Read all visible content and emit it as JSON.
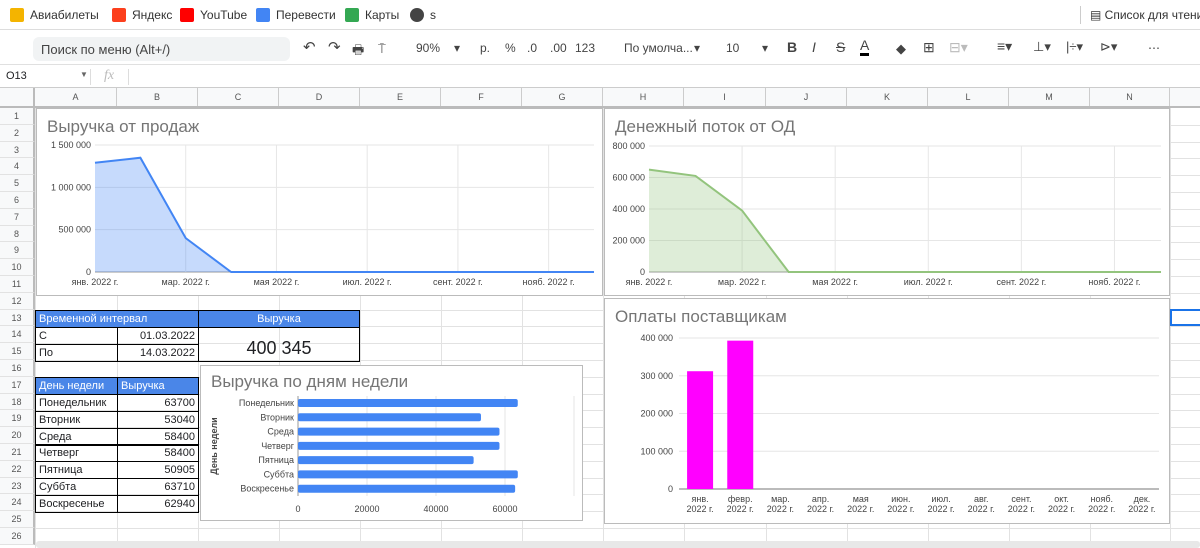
{
  "bookmarks": [
    {
      "label": "Авиабилеты",
      "icon": "tickets-icon",
      "color": "#f4b400"
    },
    {
      "label": "Яндекс",
      "icon": "yandex-icon",
      "color": "#fc3f1d"
    },
    {
      "label": "YouTube",
      "icon": "youtube-icon",
      "color": "#ff0000"
    },
    {
      "label": "Перевести",
      "icon": "translate-icon",
      "color": "#4285f4"
    },
    {
      "label": "Карты",
      "icon": "maps-icon",
      "color": "#34a853"
    },
    {
      "label": "s",
      "icon": "globe-icon",
      "color": "#444444"
    }
  ],
  "reading_list": "Список для чтения",
  "toolbar": {
    "search_placeholder": "Поиск по меню (Alt+/)",
    "zoom": "90%",
    "currency": "р.",
    "percent": "%",
    "dec_less": ".0",
    "dec_more": ".00",
    "format": "123",
    "font": "По умолча...",
    "font_size": "10",
    "more": "⋯"
  },
  "formula_bar": {
    "cell_ref": "O13",
    "fx": "fx",
    "value": ""
  },
  "columns": [
    "A",
    "B",
    "C",
    "D",
    "E",
    "F",
    "G",
    "H",
    "I",
    "J",
    "K",
    "L",
    "M",
    "N"
  ],
  "rows": [
    "1",
    "2",
    "3",
    "4",
    "5",
    "6",
    "7",
    "8",
    "9",
    "10",
    "11",
    "12",
    "13",
    "14",
    "15",
    "16",
    "17",
    "18",
    "19",
    "20",
    "21",
    "22",
    "23",
    "24",
    "25",
    "26"
  ],
  "interval_table": {
    "header": "Временной интервал",
    "revenue_header": "Выручка",
    "from_label": "С",
    "from": "01.03.2022",
    "to_label": "По",
    "to": "14.03.2022",
    "revenue": "400 345"
  },
  "weekday_table": {
    "headers": [
      "День недели",
      "Выручка"
    ],
    "rows": [
      [
        "Понедельник",
        "63700"
      ],
      [
        "Вторник",
        "53040"
      ],
      [
        "Среда",
        "58400"
      ],
      [
        "Четверг",
        "58400"
      ],
      [
        "Пятница",
        "50905"
      ],
      [
        "Суббта",
        "63710"
      ],
      [
        "Воскресенье",
        "62940"
      ]
    ]
  },
  "chart_data": [
    {
      "type": "area",
      "title": "Выручка от продаж",
      "color": "#4285f4",
      "x": [
        "янв. 2022 г.",
        "февр. 2022 г.",
        "мар. 2022 г.",
        "апр. 2022 г.",
        "мая 2022 г.",
        "июн. 2022 г.",
        "июл. 2022 г.",
        "авг. 2022 г.",
        "сент. 2022 г.",
        "окт. 2022 г.",
        "нояб. 2022 г.",
        "дек. 2022 г."
      ],
      "values": [
        1290000,
        1350000,
        400000,
        0,
        0,
        0,
        0,
        0,
        0,
        0,
        0,
        0
      ],
      "xticks": [
        "янв. 2022 г.",
        "мар. 2022 г.",
        "мая 2022 г.",
        "июл. 2022 г.",
        "сент. 2022 г.",
        "нояб. 2022 г."
      ],
      "yticks": [
        "0",
        "500 000",
        "1 000 000",
        "1 500 000"
      ],
      "ylim": [
        0,
        1500000
      ],
      "grid": true
    },
    {
      "type": "area",
      "title": "Денежный поток от ОД",
      "color": "#93c47d",
      "x": [
        "янв. 2022 г.",
        "февр. 2022 г.",
        "мар. 2022 г.",
        "апр. 2022 г.",
        "мая 2022 г.",
        "июн. 2022 г.",
        "июл. 2022 г.",
        "авг. 2022 г.",
        "сент. 2022 г.",
        "окт. 2022 г.",
        "нояб. 2022 г.",
        "дек. 2022 г."
      ],
      "values": [
        650000,
        610000,
        390000,
        0,
        0,
        0,
        0,
        0,
        0,
        0,
        0,
        0
      ],
      "xticks": [
        "янв. 2022 г.",
        "мар. 2022 г.",
        "мая 2022 г.",
        "июл. 2022 г.",
        "сент. 2022 г.",
        "нояб. 2022 г."
      ],
      "yticks": [
        "0",
        "200 000",
        "400 000",
        "600 000",
        "800 000"
      ],
      "ylim": [
        0,
        800000
      ],
      "grid": true
    },
    {
      "type": "bar",
      "orientation": "horizontal",
      "title": "Выручка по дням недели",
      "ylabel": "День недели",
      "color": "#4285f4",
      "categories": [
        "Понедельник",
        "Вторник",
        "Среда",
        "Четверг",
        "Пятница",
        "Суббта",
        "Воскресенье"
      ],
      "values": [
        63700,
        53040,
        58400,
        58400,
        50905,
        63710,
        62940
      ],
      "xticks": [
        "0",
        "20000",
        "40000",
        "60000"
      ],
      "xlim": [
        0,
        80000
      ],
      "grid": true
    },
    {
      "type": "bar",
      "title": "Оплаты поставщикам",
      "color": "#ff00ff",
      "categories": [
        "янв. 2022 г.",
        "февр. 2022 г.",
        "мар. 2022 г.",
        "апр. 2022 г.",
        "мая 2022 г.",
        "июн. 2022 г.",
        "июл. 2022 г.",
        "авг. 2022 г.",
        "сент. 2022 г.",
        "окт. 2022 г.",
        "нояб. 2022 г.",
        "дек. 2022 г."
      ],
      "values": [
        312000,
        393000,
        0,
        0,
        0,
        0,
        0,
        0,
        0,
        0,
        0,
        0
      ],
      "yticks": [
        "0",
        "100 000",
        "200 000",
        "300 000",
        "400 000"
      ],
      "ylim": [
        0,
        400000
      ],
      "grid": true
    }
  ]
}
